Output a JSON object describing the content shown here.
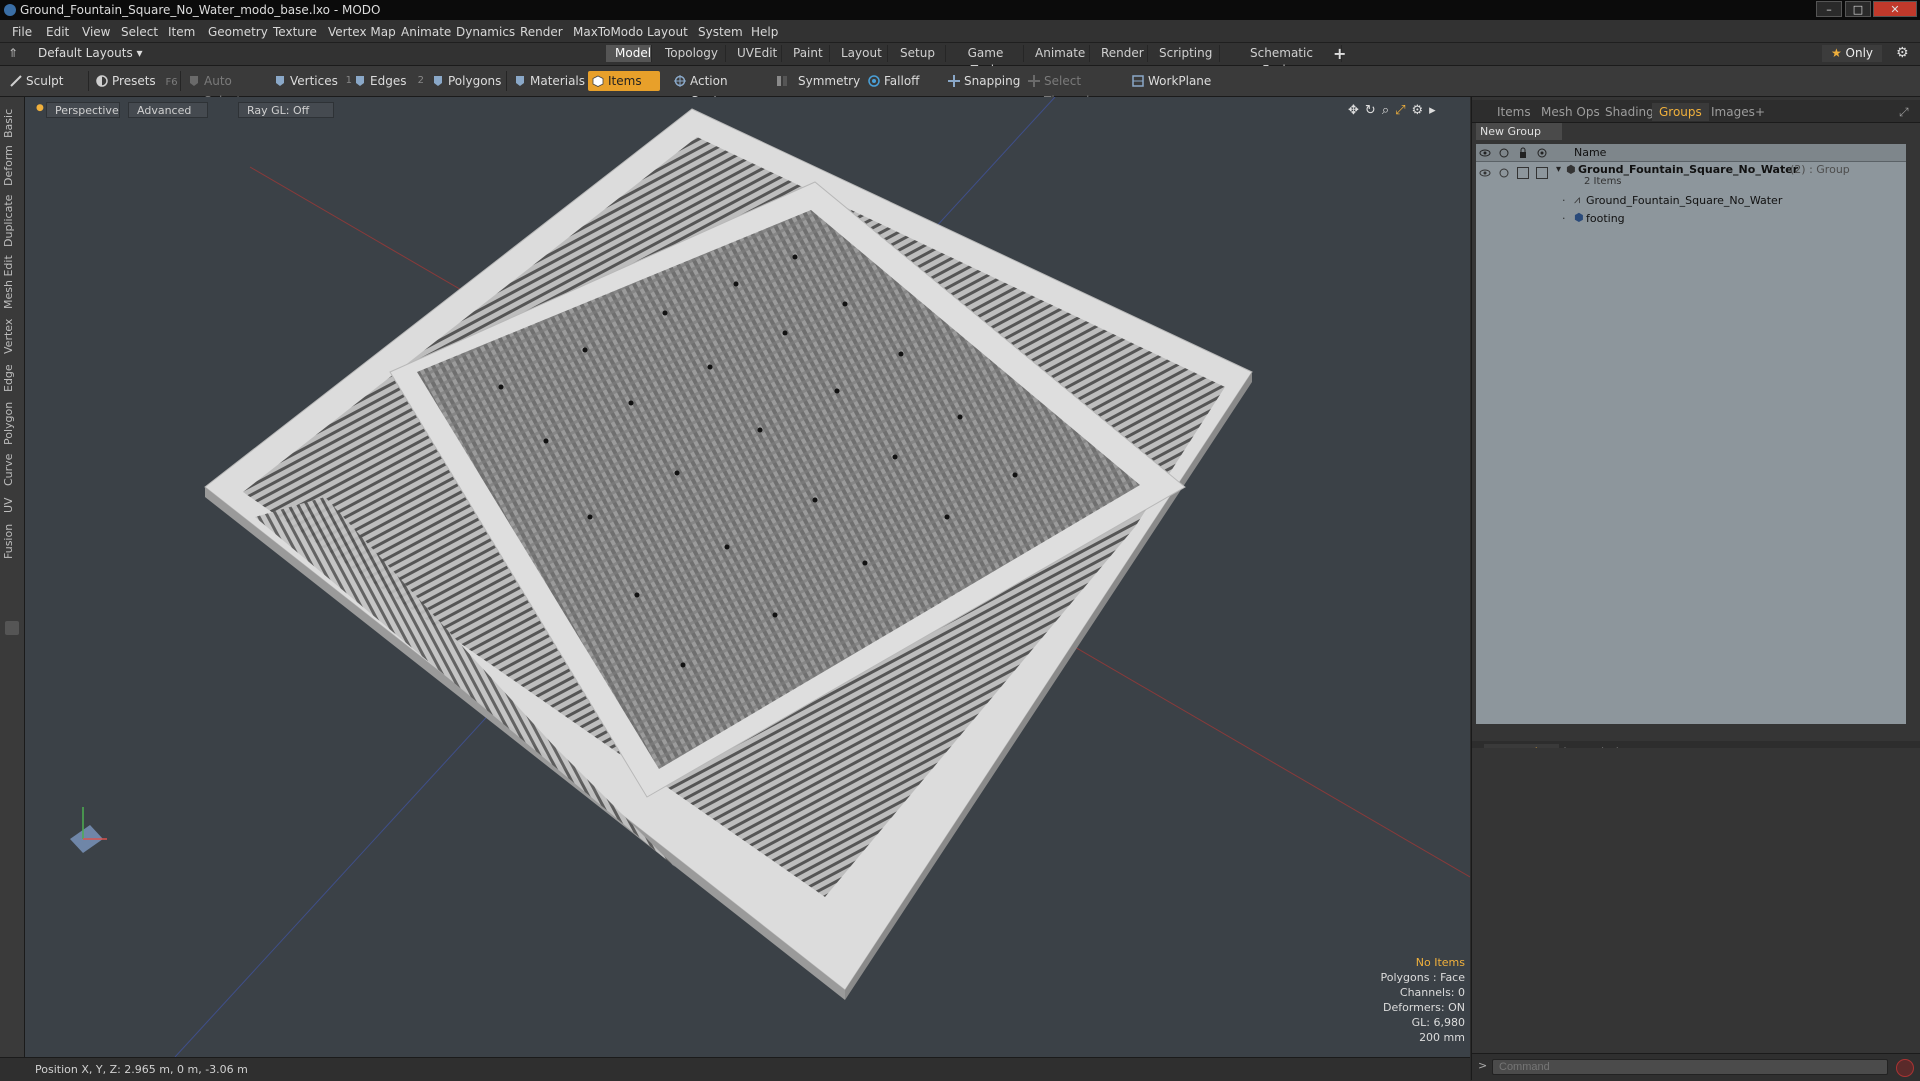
{
  "window": {
    "title": "Ground_Fountain_Square_No_Water_modo_base.lxo - MODO",
    "buttons": {
      "minimize": "–",
      "maximize": "□",
      "close": "✕"
    }
  },
  "menubar": [
    "File",
    "Edit",
    "View",
    "Select",
    "Item",
    "Geometry",
    "Texture",
    "Vertex Map",
    "Animate",
    "Dynamics",
    "Render",
    "MaxToModo",
    "Layout",
    "System",
    "Help"
  ],
  "layoutbar": {
    "layouts_label": "Default Layouts",
    "tabs": [
      "Model",
      "Topology",
      "UVEdit",
      "Paint",
      "Layout",
      "Setup",
      "Game Tools",
      "Animate",
      "Render",
      "Scripting",
      "Schematic Fusion"
    ],
    "active_tab": "Model",
    "add": "+",
    "only_label": "Only"
  },
  "toolbar": {
    "sculpt": "Sculpt",
    "presets": "Presets",
    "presets_key": "F6",
    "auto_select": "Auto Select",
    "vertices": "Vertices",
    "vertices_count": "1",
    "edges": "Edges",
    "edges_count": "2",
    "polygons": "Polygons",
    "materials": "Materials",
    "items": "Items",
    "action_center": "Action Center",
    "symmetry": "Symmetry",
    "falloff": "Falloff",
    "snapping": "Snapping",
    "select_through": "Select Through",
    "workplane": "WorkPlane"
  },
  "left_tabs": [
    "Basic",
    "Deform",
    "Duplicate",
    "Mesh Edit",
    "Vertex",
    "Edge",
    "Polygon",
    "Curve",
    "UV",
    "Fusion"
  ],
  "viewport": {
    "view_mode": "Perspective",
    "shading": "Advanced",
    "raygl": "Ray GL: Off",
    "info": {
      "selection": "No Items",
      "polygons": "Polygons : Face",
      "channels": "Channels: 0",
      "deformers": "Deformers: ON",
      "gl": "GL: 6,980",
      "scale": "200 mm"
    }
  },
  "statusbar": {
    "position": "Position X, Y, Z:  2.965 m, 0 m, -3.06 m"
  },
  "right_panel": {
    "top_tabs": [
      "Items",
      "Mesh Ops",
      "Shading",
      "Groups",
      "Images"
    ],
    "active_top_tab": "Groups",
    "new_group": "New Group",
    "list_header_name": "Name",
    "group": {
      "name": "Ground_Fountain_Square_No_Water",
      "suffix": "(2) : Group",
      "count": "2 Items",
      "children": [
        "Ground_Fountain_Square_No_Water",
        "footing"
      ]
    },
    "bottom_tabs": [
      "Properties",
      "Channels",
      "Lists"
    ],
    "active_bottom_tab": "Properties",
    "command_placeholder": "Command"
  },
  "colors": {
    "accent": "#f0b03c",
    "viewport_bg": "#3b4147",
    "active_tool": "#e8a02a"
  }
}
